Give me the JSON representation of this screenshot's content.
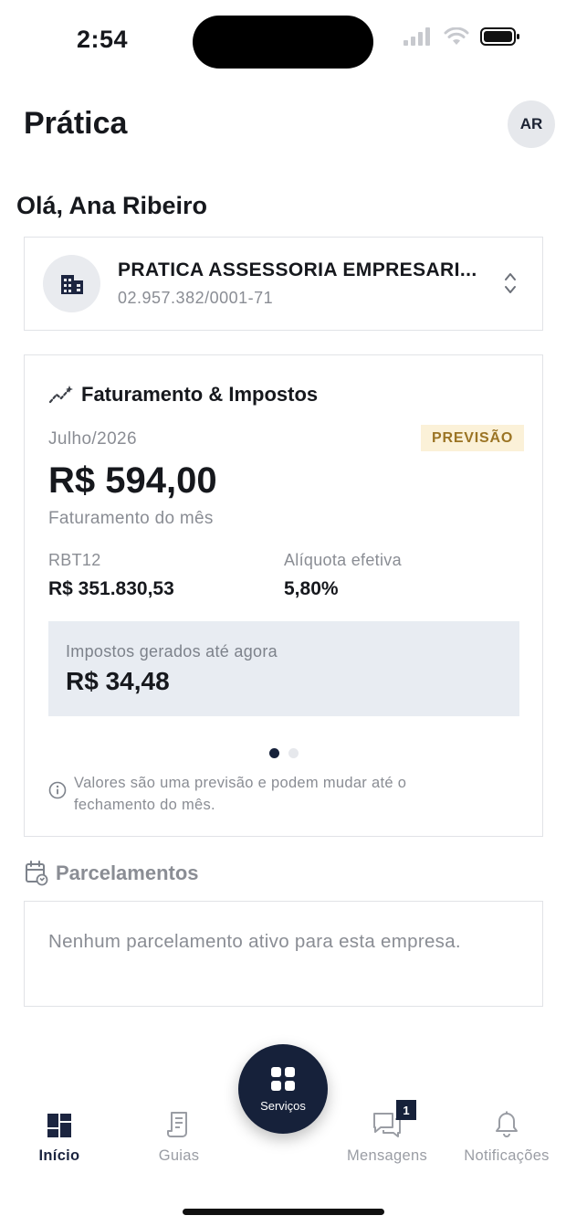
{
  "status_bar": {
    "time": "2:54"
  },
  "header": {
    "title": "Prática",
    "avatar_initials": "AR"
  },
  "greeting": "Olá, Ana Ribeiro",
  "company": {
    "name": "PRATICA ASSESSORIA EMPRESARI...",
    "cnpj": "02.957.382/0001-71",
    "icon": "building-icon"
  },
  "billing": {
    "title": "Faturamento & Impostos",
    "period": "Julho/2026",
    "badge": "PREVISÃO",
    "revenue_value": "R$ 594,00",
    "revenue_label": "Faturamento do mês",
    "rbt12_label": "RBT12",
    "rbt12_value": "R$ 351.830,53",
    "rate_label": "Alíquota efetiva",
    "rate_value": "5,80%",
    "taxes_label": "Impostos gerados até agora",
    "taxes_value": "R$ 34,48",
    "pager": {
      "pages": 2,
      "active": 1
    },
    "disclaimer": "Valores são uma previsão e podem mudar até o fechamento do mês."
  },
  "installments": {
    "title": "Parcelamentos",
    "empty_text": "Nenhum parcelamento ativo para esta empresa."
  },
  "nav": {
    "items": [
      {
        "label": "Início",
        "icon": "dashboard-icon",
        "active": true
      },
      {
        "label": "Guias",
        "icon": "receipt-icon",
        "active": false
      },
      {
        "label": "Mensagens",
        "icon": "chat-icon",
        "active": false,
        "badge": "1"
      },
      {
        "label": "Notificações",
        "icon": "bell-icon",
        "active": false
      }
    ],
    "fab_label": "Serviços"
  },
  "colors": {
    "primary": "#16213a",
    "badge_bg": "#fbf1d8",
    "badge_text": "#9b7424",
    "muted_text": "#8a8d94",
    "taxes_bg": "#e8ecf2"
  }
}
